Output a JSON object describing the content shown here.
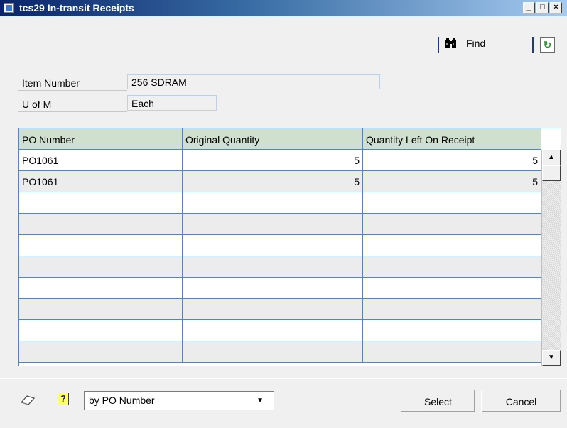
{
  "window": {
    "title": "tcs29 In-transit Receipts",
    "controls": {
      "minimize": "_",
      "maximize": "□",
      "close": "×"
    }
  },
  "toolbar": {
    "find_label": "Find",
    "find_icon": "binoculars-icon",
    "refresh_icon": "refresh-icon"
  },
  "fields": {
    "item_number": {
      "label": "Item Number",
      "value": "256 SDRAM"
    },
    "u_of_m": {
      "label": "U of M",
      "value": "Each"
    }
  },
  "grid": {
    "columns": [
      "PO Number",
      "Original Quantity",
      "Quantity Left On Receipt"
    ],
    "rows": [
      {
        "po": "PO1061",
        "original": "5",
        "left": "5"
      },
      {
        "po": "PO1061",
        "original": "5",
        "left": "5"
      },
      {
        "po": "",
        "original": "",
        "left": ""
      },
      {
        "po": "",
        "original": "",
        "left": ""
      },
      {
        "po": "",
        "original": "",
        "left": ""
      },
      {
        "po": "",
        "original": "",
        "left": ""
      },
      {
        "po": "",
        "original": "",
        "left": ""
      },
      {
        "po": "",
        "original": "",
        "left": ""
      },
      {
        "po": "",
        "original": "",
        "left": ""
      },
      {
        "po": "",
        "original": "",
        "left": ""
      }
    ]
  },
  "footer": {
    "sort_select_value": "by PO Number",
    "select_button": "Select",
    "cancel_button": "Cancel",
    "note_icon": "note-icon",
    "help_icon": "help-icon"
  },
  "colors": {
    "title_bar": "#0a246a",
    "grid_header": "#cfe0cf",
    "grid_border": "#5b82b3",
    "field_border": "#c0d0e4"
  }
}
